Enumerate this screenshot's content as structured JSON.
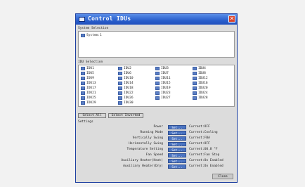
{
  "window": {
    "title": "Control IDUs",
    "close_label": "✕"
  },
  "system_selection": {
    "header": "System Selection",
    "items": [
      {
        "label": "System:1"
      }
    ]
  },
  "idu_selection": {
    "header": "IDU Selection",
    "rows": [
      [
        "IDU1",
        "IDU2",
        "IDU3",
        "IDU4"
      ],
      [
        "IDU5",
        "IDU6",
        "IDU7",
        "IDU8"
      ],
      [
        "IDU9",
        "IDU10",
        "IDU11",
        "IDU12"
      ],
      [
        "IDU13",
        "IDU14",
        "IDU15",
        "IDU16"
      ],
      [
        "IDU17",
        "IDU18",
        "IDU19",
        "IDU20"
      ],
      [
        "IDU21",
        "IDU22",
        "IDU23",
        "IDU24"
      ],
      [
        "IDU25",
        "IDU26",
        "IDU27",
        "IDU28"
      ],
      [
        "IDU29",
        "IDU30",
        "",
        ""
      ]
    ],
    "select_all_label": "Select All",
    "select_inverted_label": "Select Inverted"
  },
  "settings": {
    "header": "Settings",
    "set_label": "Set...",
    "items": [
      {
        "label": "Power",
        "value": "Current:OFF"
      },
      {
        "label": "Running Mode",
        "value": "Current:Cooling"
      },
      {
        "label": "Vertically Swing",
        "value": "Current:FBA"
      },
      {
        "label": "Horizontally Swing",
        "value": "Current:OFF"
      },
      {
        "label": "Temperature Setting",
        "value": "Current:60.8 °F"
      },
      {
        "label": "Fan Speed",
        "value": "Current:Fan Stop"
      },
      {
        "label": "Auxiliary Heater(Heat)",
        "value": "Current:On Enabled"
      },
      {
        "label": "Auxiliary Heater(Dry)",
        "value": "Current:On Enabled"
      }
    ]
  },
  "footer": {
    "close_label": "Close"
  }
}
